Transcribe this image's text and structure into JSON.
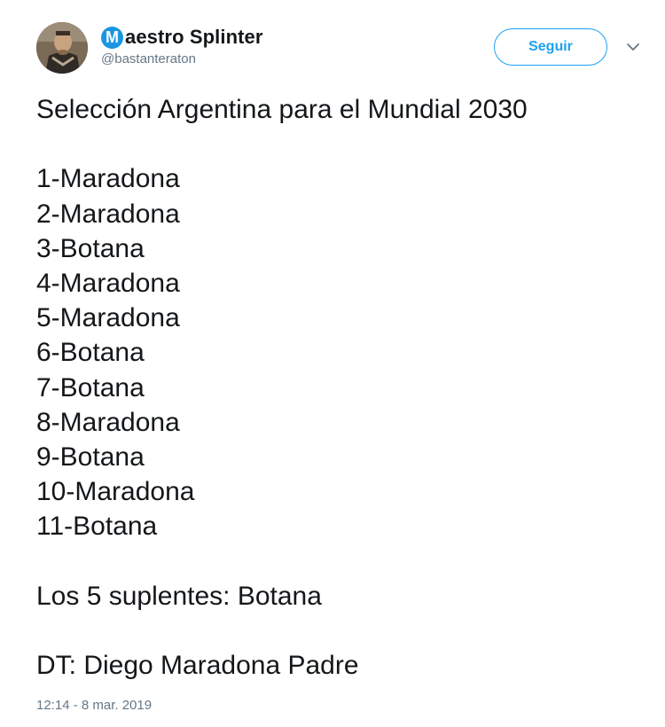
{
  "author": {
    "name_logo_letter": "M",
    "name_rest": "aestro Splinter",
    "handle": "@bastanteraton"
  },
  "follow_button": {
    "label": "Seguir"
  },
  "more_menu": {
    "icon": "chevron-down-icon"
  },
  "tweet": {
    "title": "Selección Argentina para el Mundial 2030",
    "lineup": [
      "1-Maradona",
      "2-Maradona",
      "3-Botana",
      "4-Maradona",
      "5-Maradona",
      "6-Botana",
      "7-Botana",
      "8-Maradona",
      "9-Botana",
      "10-Maradona",
      "11-Botana"
    ],
    "substitutes": "Los 5 suplentes: Botana",
    "coach": "DT: Diego Maradona Padre",
    "timestamp": "12:14 - 8 mar. 2019"
  },
  "colors": {
    "accent": "#1da1f2",
    "logo": "#1b95e0",
    "text": "#14171a",
    "muted": "#657786"
  }
}
